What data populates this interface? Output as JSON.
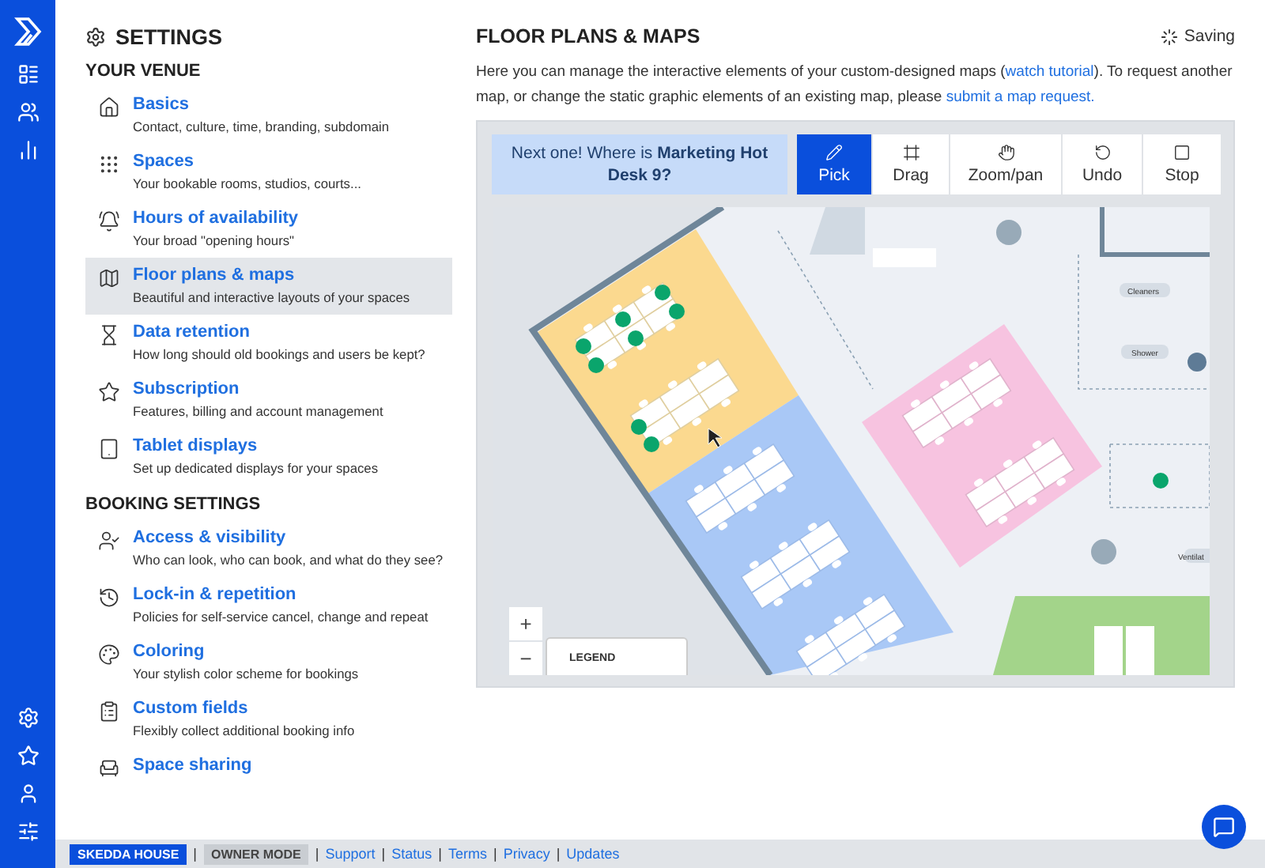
{
  "settings": {
    "title": "SETTINGS",
    "sections": [
      {
        "heading": "YOUR VENUE",
        "items": [
          {
            "title": "Basics",
            "description": "Contact, culture, time, branding, subdomain",
            "selected": false
          },
          {
            "title": "Spaces",
            "description": "Your bookable rooms, studios, courts...",
            "selected": false
          },
          {
            "title": "Hours of availability",
            "description": "Your broad \"opening hours\"",
            "selected": false
          },
          {
            "title": "Floor plans & maps",
            "description": "Beautiful and interactive layouts of your spaces",
            "selected": true
          },
          {
            "title": "Data retention",
            "description": "How long should old bookings and users be kept?",
            "selected": false
          },
          {
            "title": "Subscription",
            "description": "Features, billing and account management",
            "selected": false
          },
          {
            "title": "Tablet displays",
            "description": "Set up dedicated displays for your spaces",
            "selected": false
          }
        ]
      },
      {
        "heading": "BOOKING SETTINGS",
        "items": [
          {
            "title": "Access & visibility",
            "description": "Who can look, who can book, and what do they see?",
            "selected": false
          },
          {
            "title": "Lock-in & repetition",
            "description": "Policies for self-service cancel, change and repeat",
            "selected": false
          },
          {
            "title": "Coloring",
            "description": "Your stylish color scheme for bookings",
            "selected": false
          },
          {
            "title": "Custom fields",
            "description": "Flexibly collect additional booking info",
            "selected": false
          },
          {
            "title": "Space sharing",
            "selected": false
          }
        ]
      }
    ]
  },
  "page": {
    "title": "FLOOR PLANS & MAPS",
    "status": "Saving",
    "intro": [
      {
        "text": "Here you can manage the interactive elements of your custom-designed maps (",
        "link": false
      },
      {
        "text": "watch tutorial",
        "link": true
      },
      {
        "text": "). To request another map, or change the static graphic elements of an existing map, please ",
        "link": false
      },
      {
        "text": "submit a map request.",
        "link": true
      }
    ]
  },
  "toolbar": {
    "hint": "Next one! Where is **Marketing Hot Desk 9?**",
    "tools": [
      {
        "label": "Pick",
        "selected": true
      },
      {
        "label": "Drag",
        "selected": false
      },
      {
        "label": "Zoom/pan",
        "selected": false
      },
      {
        "label": "Undo",
        "selected": false
      },
      {
        "label": "Stop",
        "selected": false
      }
    ]
  },
  "map": {
    "room_labels": [
      "Cleaners",
      "Shower",
      "Ventilat"
    ],
    "zoom_in": "+",
    "zoom_out": "−",
    "legend": "LEGEND"
  },
  "footer": {
    "items": [
      {
        "kind": "badge",
        "label": "SKEDDA HOUSE"
      },
      {
        "kind": "sep",
        "label": "|"
      },
      {
        "kind": "muted",
        "label": "OWNER MODE"
      },
      {
        "kind": "sep",
        "label": "|"
      },
      {
        "kind": "link",
        "label": "Support"
      },
      {
        "kind": "sep",
        "label": "|"
      },
      {
        "kind": "link",
        "label": "Status"
      },
      {
        "kind": "sep",
        "label": "|"
      },
      {
        "kind": "link",
        "label": "Terms"
      },
      {
        "kind": "sep",
        "label": "|"
      },
      {
        "kind": "link",
        "label": "Privacy"
      },
      {
        "kind": "sep",
        "label": "|"
      },
      {
        "kind": "link",
        "label": "Updates"
      }
    ]
  }
}
